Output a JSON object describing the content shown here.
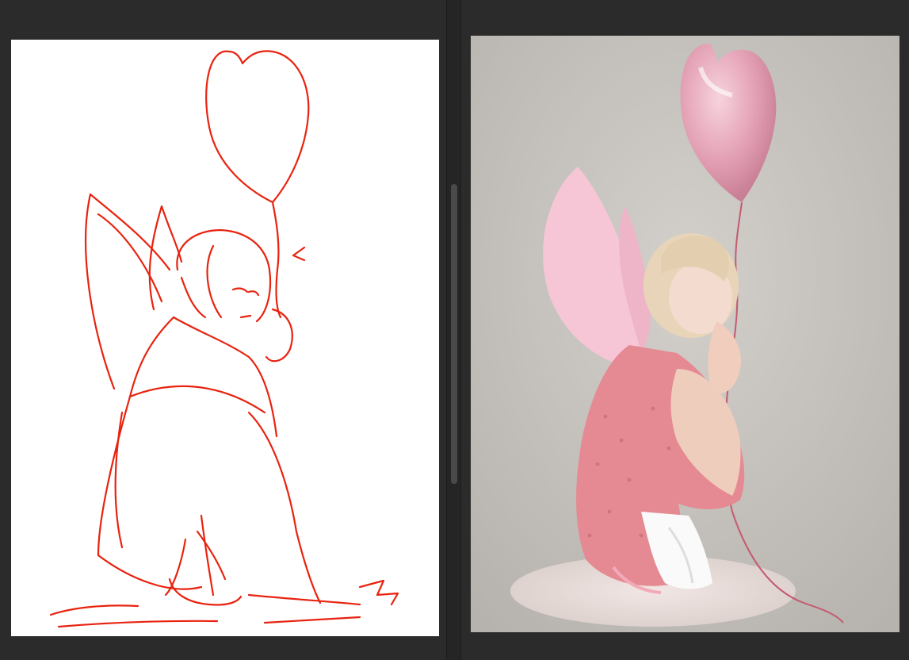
{
  "colors": {
    "app_background": "#2b2b2b",
    "splitter": "#252525",
    "splitter_thumb": "#4a4a4a",
    "sketch_canvas": "#ffffff",
    "sketch_stroke": "#e8230f",
    "photo_backdrop": "#c8c5c0",
    "balloon_pink": "#e8a2b6",
    "dress_pink": "#e58a93",
    "wing_pink": "#f6c6d6",
    "indicator_green": "#1fd17a"
  },
  "panes": {
    "left": {
      "content": "line-sketch"
    },
    "right": {
      "content": "reference-photo"
    }
  },
  "icons": {
    "indicator": "active-tool-indicator-icon"
  }
}
